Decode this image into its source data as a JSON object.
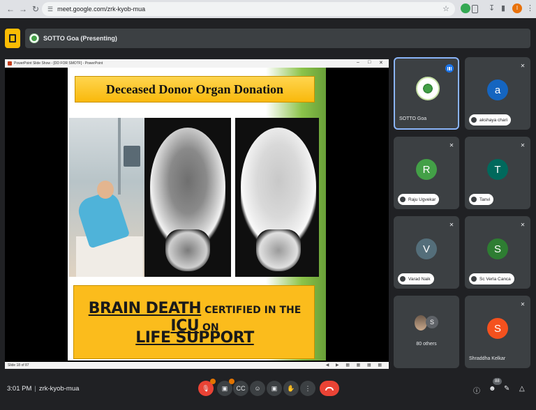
{
  "browser": {
    "url": "meet.google.com/zrk-kyob-mua",
    "profile_initial": "I"
  },
  "meet": {
    "presenting_label": "SOTTO Goa (Presenting)",
    "time": "3:01 PM",
    "separator": "|",
    "meeting_code": "zrk-kyob-mua",
    "people_count": "88"
  },
  "ppt": {
    "window_title": "PowerPoint Slide Show - [DD FOR SMOTF] - PowerPoint",
    "slide_counter": "Slide 18 of 87"
  },
  "slide": {
    "title": "Deceased Donor Organ Donation",
    "line1_part1": "BRAIN DEATH",
    "line1_part2": " CERTIFIED IN THE ",
    "line1_part3": "ICU",
    "line1_part4": " ON",
    "line2": "LIFE SUPPORT"
  },
  "participants": [
    {
      "name": "SOTTO Goa",
      "type": "logo",
      "speaking": true
    },
    {
      "name": "akshaya chari",
      "initial": "a",
      "color": "#1565c0",
      "muted": true
    },
    {
      "name": "Raju Ugvekar",
      "initial": "R",
      "color": "#43a047",
      "muted": true
    },
    {
      "name": "Tanvi",
      "initial": "T",
      "color": "#00695c",
      "muted": true
    },
    {
      "name": "Varad Naik",
      "initial": "V",
      "color": "#546e7a",
      "muted": true
    },
    {
      "name": "Sc Verla Canca",
      "initial": "S",
      "color": "#2e7d32",
      "muted": true
    },
    {
      "name": "Shraddha Kelkar",
      "initial": "S",
      "color": "#f4511e",
      "muted": true
    }
  ],
  "others": {
    "label": "80 others",
    "initial": "S"
  },
  "icons": {
    "back": "back-arrow-icon",
    "forward": "forward-arrow-icon",
    "reload": "reload-icon",
    "star": "star-icon",
    "mic_off": "mic-off-icon"
  }
}
